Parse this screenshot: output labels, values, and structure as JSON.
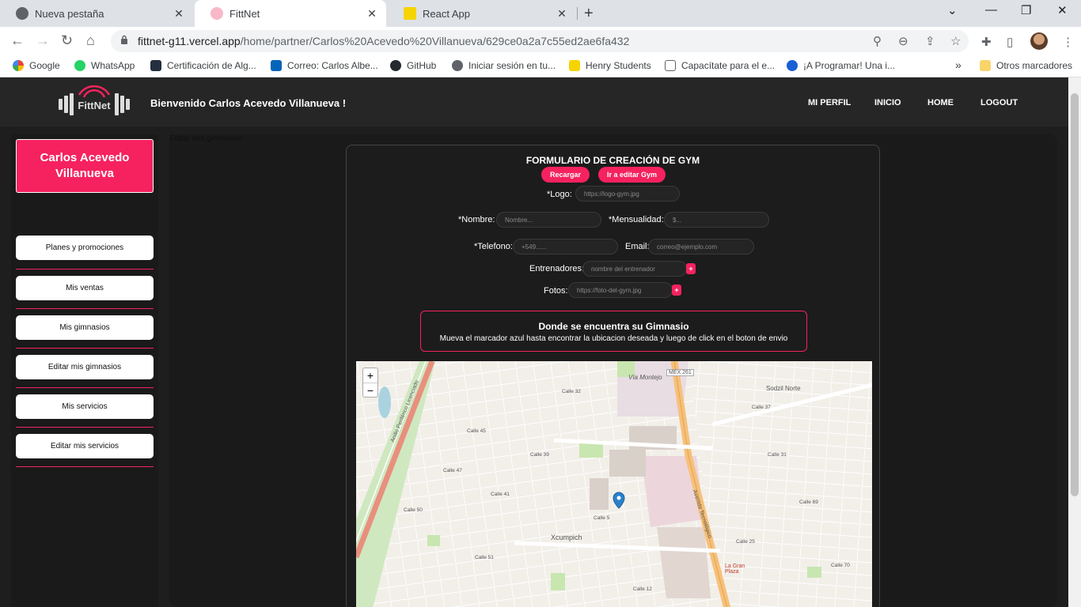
{
  "browser": {
    "tabs": [
      {
        "title": "Nueva pestaña"
      },
      {
        "title": "FittNet"
      },
      {
        "title": "React App"
      }
    ],
    "url_main": "fittnet-g11.vercel.app",
    "url_path": "/home/partner/Carlos%20Acevedo%20Villanueva/629ce0a2a7c55ed2ae6fa432",
    "bookmarks": [
      {
        "label": "Google"
      },
      {
        "label": "WhatsApp"
      },
      {
        "label": "Certificación de Alg..."
      },
      {
        "label": "Correo: Carlos Albe..."
      },
      {
        "label": "GitHub"
      },
      {
        "label": "Iniciar sesión en tu..."
      },
      {
        "label": "Henry Students"
      },
      {
        "label": "Capacítate para el e..."
      },
      {
        "label": "¡A Programar! Una i..."
      }
    ],
    "bookmarks_more": "»",
    "other_bookmarks": "Otros marcadores"
  },
  "header": {
    "logo_text": "FittNet",
    "welcome": "Bienvenido Carlos Acevedo Villanueva !",
    "nav": [
      "MI PERFIL",
      "INICIO",
      "HOME",
      "LOGOUT"
    ]
  },
  "sidebar": {
    "profile_name": "Carlos Acevedo Villanueva",
    "items": [
      "Planes y promociones",
      "Mis ventas",
      "Mis gimnasios",
      "Editar mis gimnasios",
      "Mis servicios",
      "Editar mis servicios"
    ]
  },
  "main": {
    "breadcrumb": "Editar mis gimnasios"
  },
  "form": {
    "title": "FORMULARIO DE CREACIÓN DE GYM",
    "reload_label": "Recargar",
    "edit_label": "Ir a editar Gym",
    "logo_label": "*Logo:",
    "logo_placeholder": "https://logo-gym.jpg",
    "name_label": "*Nombre:",
    "name_placeholder": "Nombre...",
    "price_label": "*Mensualidad:",
    "price_placeholder": "$...",
    "phone_label": "*Telefono:",
    "phone_placeholder": "+549......",
    "email_label": "Email:",
    "email_placeholder": "correo@ejemplo.com",
    "trainers_label": "Entrenadores:",
    "trainers_placeholder": "nombre del entrenador",
    "photos_label": "Fotos:",
    "photos_placeholder": "https://foto-del-gym.jpg",
    "add_symbol": "+"
  },
  "location": {
    "title": "Donde se encuentra su Gimnasio",
    "subtitle": "Mueva el marcador azul hasta encontrar la ubicacion deseada y luego de click en el boton de envio"
  },
  "map": {
    "zoom_in": "+",
    "zoom_out": "−",
    "labels": {
      "district": "Xcumpich",
      "villa": "Vía Montejo",
      "highway": "MEX 261",
      "north": "Sodzil Norte",
      "plaza": "La Gran Plaza",
      "avenue": "Avenida Tecnológico",
      "periferico": "Anillo Periférico Licenciado"
    },
    "colors": {
      "land": "#f2efe9",
      "street": "#ffffff",
      "avenue": "#f7c07a",
      "park": "#c8e6b0",
      "periferico": "#e88f7e",
      "building": "#e2d6d0"
    }
  },
  "colors": {
    "accent": "#f5225f",
    "page_bg": "#1e1e1e",
    "panel_bg": "#1a1a1a"
  }
}
